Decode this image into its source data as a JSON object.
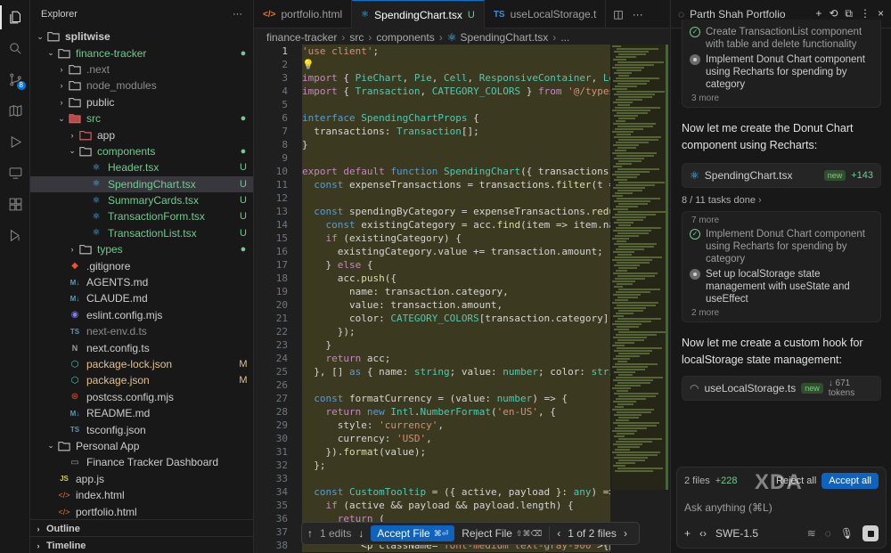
{
  "explorer": {
    "title": "Explorer",
    "more": "···",
    "rows": [
      {
        "indent": 0,
        "chev": "▾",
        "icon": "folder",
        "label": "splitwise",
        "status": "",
        "bold": true
      },
      {
        "indent": 1,
        "chev": "▾",
        "icon": "folder",
        "label": "finance-tracker",
        "status": "●",
        "cls": "c-green"
      },
      {
        "indent": 2,
        "chev": "›",
        "icon": "folder",
        "label": ".next",
        "status": "",
        "cls": "c-gray"
      },
      {
        "indent": 2,
        "chev": "›",
        "icon": "folder",
        "label": "node_modules",
        "status": "",
        "cls": "c-gray"
      },
      {
        "indent": 2,
        "chev": "›",
        "icon": "folder",
        "label": "public",
        "status": ""
      },
      {
        "indent": 2,
        "chev": "▾",
        "icon": "folder-src",
        "label": "src",
        "status": "●",
        "cls": "c-green"
      },
      {
        "indent": 3,
        "chev": "›",
        "icon": "folder-app",
        "label": "app",
        "status": ""
      },
      {
        "indent": 3,
        "chev": "▾",
        "icon": "folder",
        "label": "components",
        "status": "●",
        "cls": "c-green"
      },
      {
        "indent": 4,
        "chev": "",
        "icon": "react",
        "label": "Header.tsx",
        "status": "U",
        "cls": "c-green"
      },
      {
        "indent": 4,
        "chev": "",
        "icon": "react",
        "label": "SpendingChart.tsx",
        "status": "U",
        "cls": "c-green",
        "selected": true
      },
      {
        "indent": 4,
        "chev": "",
        "icon": "react",
        "label": "SummaryCards.tsx",
        "status": "U",
        "cls": "c-green"
      },
      {
        "indent": 4,
        "chev": "",
        "icon": "react",
        "label": "TransactionForm.tsx",
        "status": "U",
        "cls": "c-green"
      },
      {
        "indent": 4,
        "chev": "",
        "icon": "react",
        "label": "TransactionList.tsx",
        "status": "U",
        "cls": "c-green"
      },
      {
        "indent": 3,
        "chev": "›",
        "icon": "folder",
        "label": "types",
        "status": "●",
        "cls": "c-green"
      },
      {
        "indent": 2,
        "chev": "",
        "icon": "git",
        "label": ".gitignore",
        "status": ""
      },
      {
        "indent": 2,
        "chev": "",
        "icon": "md",
        "label": "AGENTS.md",
        "status": ""
      },
      {
        "indent": 2,
        "chev": "",
        "icon": "md",
        "label": "CLAUDE.md",
        "status": ""
      },
      {
        "indent": 2,
        "chev": "",
        "icon": "eslint",
        "label": "eslint.config.mjs",
        "status": ""
      },
      {
        "indent": 2,
        "chev": "",
        "icon": "ts",
        "label": "next-env.d.ts",
        "status": "",
        "cls": "c-gray"
      },
      {
        "indent": 2,
        "chev": "",
        "icon": "next",
        "label": "next.config.ts",
        "status": ""
      },
      {
        "indent": 2,
        "chev": "",
        "icon": "npm",
        "label": "package-lock.json",
        "status": "M",
        "cls": "c-yellow"
      },
      {
        "indent": 2,
        "chev": "",
        "icon": "npm",
        "label": "package.json",
        "status": "M",
        "cls": "c-yellow"
      },
      {
        "indent": 2,
        "chev": "",
        "icon": "postcss",
        "label": "postcss.config.mjs",
        "status": ""
      },
      {
        "indent": 2,
        "chev": "",
        "icon": "md",
        "label": "README.md",
        "status": ""
      },
      {
        "indent": 2,
        "chev": "",
        "icon": "ts",
        "label": "tsconfig.json",
        "status": ""
      },
      {
        "indent": 1,
        "chev": "▾",
        "icon": "folder",
        "label": "Personal App",
        "status": ""
      },
      {
        "indent": 2,
        "chev": "",
        "icon": "file",
        "label": "Finance Tracker Dashboard",
        "status": ""
      },
      {
        "indent": 1,
        "chev": "",
        "icon": "js",
        "label": "app.js",
        "status": ""
      },
      {
        "indent": 1,
        "chev": "",
        "icon": "html",
        "label": "index.html",
        "status": ""
      },
      {
        "indent": 1,
        "chev": "",
        "icon": "html",
        "label": "portfolio.html",
        "status": ""
      }
    ],
    "outline": "Outline",
    "timeline": "Timeline"
  },
  "tabs": [
    {
      "label": "portfolio.html",
      "icon": "</>",
      "iconColor": "#e37933",
      "mark": ""
    },
    {
      "label": "SpendingChart.tsx",
      "icon": "⚛",
      "iconColor": "#4fc1ff",
      "mark": "U",
      "active": true
    },
    {
      "label": "useLocalStorage.t",
      "icon": "TS",
      "iconColor": "#3c8ed8",
      "mark": ""
    }
  ],
  "breadcrumb": [
    "finance-tracker",
    "src",
    "components",
    "SpendingChart.tsx",
    "..."
  ],
  "code": {
    "first_line": 1,
    "current_line": 1,
    "lines": [
      "'use client';",
      "",
      "import { PieChart, Pie, Cell, ResponsiveContainer, Legend",
      "import { Transaction, CATEGORY_COLORS } from '@/types';",
      "",
      "interface SpendingChartProps {",
      "  transactions: Transaction[];",
      "}",
      "",
      "export default function SpendingChart({ transactions }: S",
      "  const expenseTransactions = transactions.filter(t => t.",
      "",
      "  const spendingByCategory = expenseTransactions.reduce((",
      "    const existingCategory = acc.find(item => item.name =",
      "    if (existingCategory) {",
      "      existingCategory.value += transaction.amount;",
      "    } else {",
      "      acc.push({",
      "        name: transaction.category,",
      "        value: transaction.amount,",
      "        color: CATEGORY_COLORS[transaction.category] || '",
      "      });",
      "    }",
      "    return acc;",
      "  }, [] as { name: string; value: number; color: string }",
      "",
      "  const formatCurrency = (value: number) => {",
      "    return new Intl.NumberFormat('en-US', {",
      "      style: 'currency',",
      "      currency: 'USD',",
      "    }).format(value);",
      "  };",
      "",
      "  const CustomTooltip = ({ active, payload }: any) => {",
      "    if (active && payload && payload.length) {",
      "      return (",
      "        <div className=\"bg-white p-3 border rounded shadow",
      "          <p className=\"font-medium text-gray-900\">{paylo"
    ]
  },
  "diff_toolbar": {
    "edits": "1 edits",
    "accept_file": "Accept File",
    "accept_kbd": "⌘⏎",
    "reject_file": "Reject File",
    "reject_kbd": "⇧⌘⌫",
    "files": "1 of 2 files"
  },
  "chat": {
    "tab_title": "Parth Shah Portfolio",
    "card1": {
      "tasks": [
        {
          "text": "Create TransactionList component with table and delete functionality",
          "state": "done"
        },
        {
          "text": "Implement Donut Chart component using Recharts for spending by category",
          "state": "pending"
        }
      ],
      "more": "3 more"
    },
    "msg1": "Now let me create the Donut Chart component using Recharts:",
    "file1": {
      "name": "SpendingChart.tsx",
      "badge": "new",
      "delta": "+143"
    },
    "tasks_done": "8 / 11 tasks done",
    "card2": {
      "pre": "7 more",
      "tasks": [
        {
          "text": "Implement Donut Chart component using Recharts for spending by category",
          "state": "done"
        },
        {
          "text": "Set up localStorage state management with useState and useEffect",
          "state": "pending"
        }
      ],
      "more": "2 more"
    },
    "msg2": "Now let me create a custom hook for localStorage state management:",
    "file2": {
      "name": "useLocalStorage.ts",
      "badge": "new",
      "tokens": "671 tokens"
    },
    "footer": {
      "files": "2 files",
      "delta": "+228",
      "reject_all": "Reject all",
      "accept_all": "Accept all",
      "placeholder": "Ask anything (⌘L)",
      "model": "SWE-1.5"
    },
    "watermark": "XDA"
  }
}
